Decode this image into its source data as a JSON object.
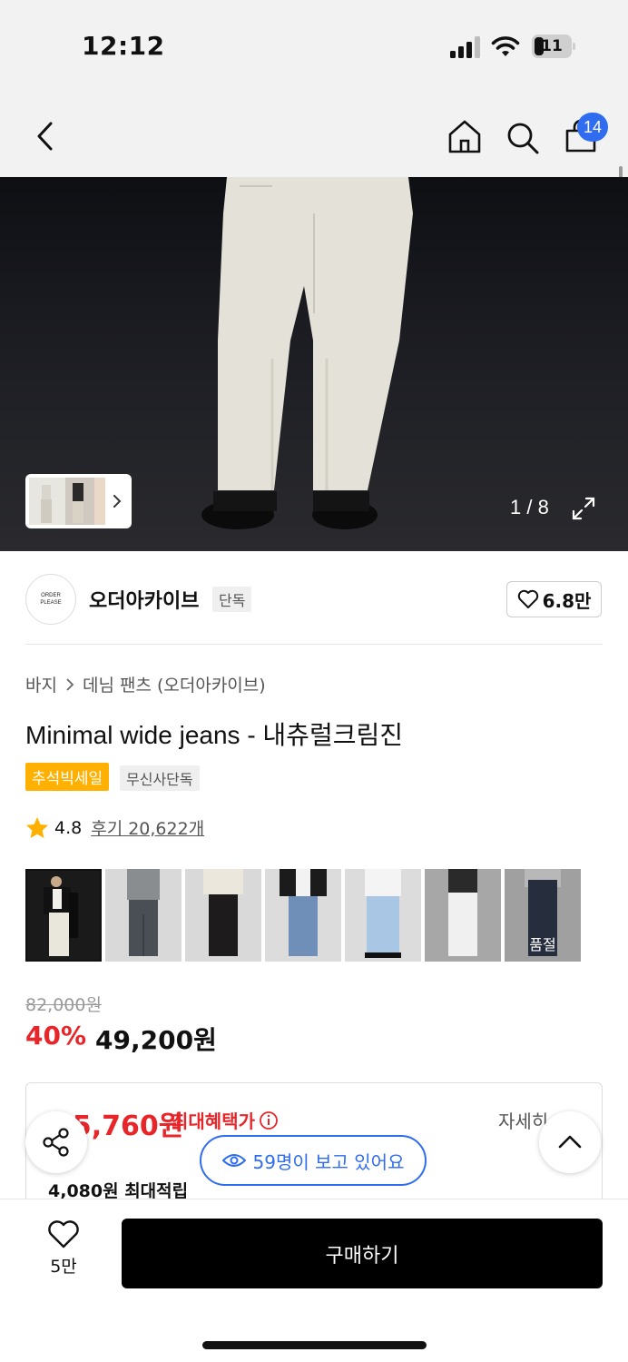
{
  "status_bar": {
    "time": "12:12",
    "battery": "11"
  },
  "nav": {
    "cart_count": "14"
  },
  "hero": {
    "page_indicator": "1 / 8"
  },
  "brand": {
    "logo_line1": "ORDER",
    "logo_line2": "PLEASE",
    "name": "오더아카이브",
    "exclusive_tag": "단독",
    "likes": "6.8만"
  },
  "breadcrumb": {
    "category": "바지",
    "subcategory": "데님 팬츠 (오더아카이브)"
  },
  "product": {
    "title": "Minimal wide jeans - 내츄럴크림진",
    "tags": [
      "추석빅세일",
      "무신사단독"
    ],
    "rating": "4.8",
    "reviews": "후기 20,622개"
  },
  "color_thumbs": [
    {
      "name": "natural-cream",
      "color": "#e9e6dc",
      "bg": "#1a1a1a"
    },
    {
      "name": "dark-gray",
      "color": "#4a4e55",
      "bg": "#d9d9d9"
    },
    {
      "name": "black",
      "color": "#1e1b1c",
      "bg": "#d9d9d9"
    },
    {
      "name": "mid-blue",
      "color": "#6f8fb8",
      "bg": "#dcdcdc"
    },
    {
      "name": "light-blue",
      "color": "#a9c6e4",
      "bg": "#dcdcdc"
    },
    {
      "name": "white",
      "color": "#f0f0f0",
      "bg": "#a7a7a7"
    },
    {
      "name": "raw-denim",
      "color": "#2d3548",
      "bg": "#bcbcbc",
      "status": "품절"
    }
  ],
  "price": {
    "original": "82,000원",
    "discount": "40%",
    "sale": "49,200원"
  },
  "benefit": {
    "max_price": "45,760원",
    "max_label": "최대혜택가",
    "detail_link": "자세히",
    "points": "4,080원 최대적립"
  },
  "viewers": "59명이 보고 있어요",
  "bottom": {
    "wish_count": "5만",
    "buy_label": "구매하기"
  },
  "colors": {
    "accent_blue": "#2f6cf0",
    "sale_red": "#e8262a",
    "tag_orange": "#ffb000"
  }
}
